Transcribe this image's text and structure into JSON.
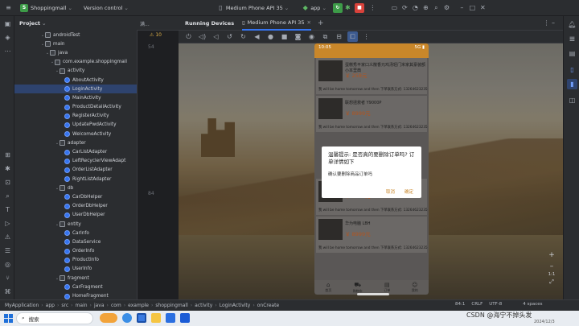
{
  "topbar": {
    "project_initial": "S",
    "project": "Shoppingmall",
    "vcs": "Version control",
    "device": "Medium Phone API 35",
    "run_config": "app"
  },
  "editor_tab": "满...",
  "running_devices": {
    "title": "Running Devices",
    "device_tab": "Medium Phone API 35"
  },
  "project_panel": {
    "title": "Project",
    "tree": [
      {
        "label": "androidTest",
        "depth": 3,
        "kind": "folder"
      },
      {
        "label": "main",
        "depth": 3,
        "kind": "folder"
      },
      {
        "label": "java",
        "depth": 4,
        "kind": "folder"
      },
      {
        "label": "com.example.shoppingmall",
        "depth": 5,
        "kind": "folder"
      },
      {
        "label": "activity",
        "depth": 6,
        "kind": "folder"
      },
      {
        "label": "AboutActivity",
        "depth": 7,
        "kind": "class"
      },
      {
        "label": "LoginActivity",
        "depth": 7,
        "kind": "class",
        "selected": true
      },
      {
        "label": "MainActivity",
        "depth": 7,
        "kind": "class"
      },
      {
        "label": "ProductDetailActivity",
        "depth": 7,
        "kind": "class"
      },
      {
        "label": "RegisterActivity",
        "depth": 7,
        "kind": "class"
      },
      {
        "label": "UpdatePwdActivity",
        "depth": 7,
        "kind": "class"
      },
      {
        "label": "WelcomeActivity",
        "depth": 7,
        "kind": "class"
      },
      {
        "label": "adapter",
        "depth": 6,
        "kind": "folder"
      },
      {
        "label": "CarListAdapter",
        "depth": 7,
        "kind": "class"
      },
      {
        "label": "LeftRecyclerViewAdapt",
        "depth": 7,
        "kind": "class"
      },
      {
        "label": "OrderListAdapter",
        "depth": 7,
        "kind": "class"
      },
      {
        "label": "RightListAdapter",
        "depth": 7,
        "kind": "class"
      },
      {
        "label": "db",
        "depth": 6,
        "kind": "folder"
      },
      {
        "label": "CarDbHelper",
        "depth": 7,
        "kind": "class"
      },
      {
        "label": "OrderDbHelper",
        "depth": 7,
        "kind": "class"
      },
      {
        "label": "UserDbHelper",
        "depth": 7,
        "kind": "class"
      },
      {
        "label": "entity",
        "depth": 6,
        "kind": "folder"
      },
      {
        "label": "CarInfo",
        "depth": 7,
        "kind": "class"
      },
      {
        "label": "DataService",
        "depth": 7,
        "kind": "class"
      },
      {
        "label": "OrderInfo",
        "depth": 7,
        "kind": "class"
      },
      {
        "label": "ProductInfo",
        "depth": 7,
        "kind": "class"
      },
      {
        "label": "UserInfo",
        "depth": 7,
        "kind": "class"
      },
      {
        "label": "fragment",
        "depth": 6,
        "kind": "folder"
      },
      {
        "label": "CarFragment",
        "depth": 7,
        "kind": "class"
      },
      {
        "label": "HomeFragment",
        "depth": 7,
        "kind": "class"
      }
    ]
  },
  "editor": {
    "lines": [
      "54",
      "84"
    ],
    "warn": "10"
  },
  "phone": {
    "time": "10:05",
    "signal": "5G",
    "cards": [
      {
        "name": "蛋糕秀平家口义散香元鸡汤轻门米家其豪装额小本里典",
        "price": "￥ 258元",
        "foot": "我 will be home tomorrow and then 下单联系方式: 13264623235"
      },
      {
        "name": "联想拯救者 Y9000P",
        "price": "￥ 8999元",
        "foot": "我 will be home tomorrow and then 下单联系方式: 13264623235"
      },
      {
        "name": "联想笔记本 小新",
        "price": "￥ 3199元",
        "foot": "我 will be home tomorrow and then 下单联系方式: 13264623235"
      },
      {
        "name": "华为电脑 LBH",
        "price": "￥ 8999元",
        "foot": "我 will be home tomorrow and then 下单联系方式: 13264623235"
      }
    ],
    "nav": [
      "首页",
      "购物车",
      "订单",
      "我的"
    ]
  },
  "dialog": {
    "title": "温馨提示: 是否真的要删除订单吗? 订单详情如下",
    "message": "确认要删除商品订单吗",
    "cancel": "取消",
    "ok": "确定"
  },
  "breadcrumb": [
    "MyApplication",
    "app",
    "src",
    "main",
    "java",
    "com",
    "example",
    "shoppingmall",
    "activity",
    "LoginActivity",
    "onCreate"
  ],
  "statusbar": {
    "pos": "84:1",
    "eol": "CRLF",
    "enc": "UTF-8",
    "indent": "4 spaces"
  },
  "zoom": {
    "ratio": "1:1"
  },
  "taskbar": {
    "search": "搜索",
    "watermark": "CSDN @海宁不掉头发",
    "date": "2024/12/3"
  }
}
